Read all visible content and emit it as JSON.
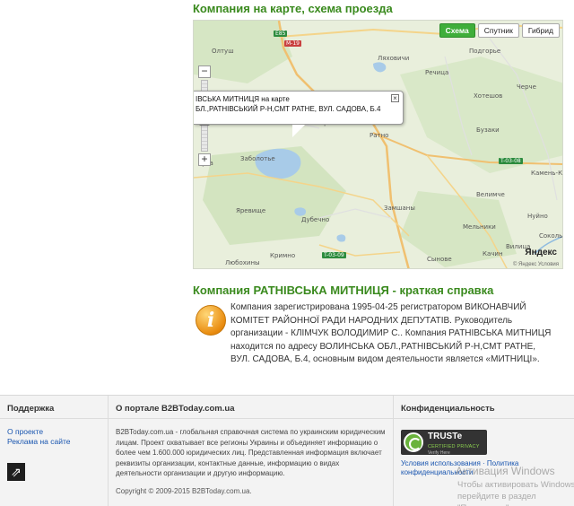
{
  "map_section": {
    "title": "Компания на карте, схема проезда",
    "map_types": [
      "Схема",
      "Спутник",
      "Гибрид"
    ],
    "active_type": "Схема",
    "zoom_in": "+",
    "zoom_out": "−",
    "balloon_line1": "ІВСЬКА МИТНИЦЯ на карте",
    "balloon_line2": "БЛ.,РАТНІВСЬКИЙ Р-Н,СМТ РАТНЕ, ВУЛ. САДОВА, Б.4",
    "balloon_close": "×",
    "places": [
      "Ляховичи",
      "Олтуш",
      "Жиричи",
      "Ратно",
      "Заболотье",
      "Гута",
      "Яревище",
      "Дубечно",
      "Кримно",
      "Любохины",
      "Речица",
      "Подгорье",
      "Черче",
      "Хотешов",
      "Бузаки",
      "Велимче",
      "Замшаны",
      "Сынове",
      "Качин",
      "Камень-Ка",
      "Нуйно",
      "Соколы",
      "Мельники",
      "Вилица"
    ],
    "roads": [
      "E85",
      "M-19",
      "T-03-08",
      "T-03-09"
    ],
    "yandex_logo": "Яндекс",
    "map_copyright": "© Яндекс Условия"
  },
  "summary_section": {
    "title": "Компания РАТНІВСЬКА МИТНИЦЯ - краткая справка",
    "icon_letter": "i",
    "text": "Компания зарегистрирована 1995-04-25 регистратором ВИКОНАВЧИЙ КОМІТЕТ РАЙОННОЇ РАДИ НАРОДНИХ ДЕПУТАТІВ. Руководитель организации - КЛІМЧУК ВОЛОДИМИР С.. Компания РАТНІВСЬКА МИТНИЦЯ находится по адресу ВОЛИНСЬКА ОБЛ.,РАТНІВСЬКИЙ Р-Н,СМТ РАТНЕ, ВУЛ. САДОВА, Б.4, основным видом деятельности является «МИТНИЦІ»."
  },
  "footer": {
    "support": {
      "heading": "Поддержка",
      "links": [
        "О проекте",
        "Реклама на сайте"
      ],
      "share_glyph": "⇗"
    },
    "about": {
      "heading": "О портале B2BToday.com.ua",
      "text": "B2BToday.com.ua - глобальная справочная система по украинским юридическим лицам. Проект охватывает все регионы Украины и объединяет информацию о более чем 1.600.000 юридических лиц. Представленная информация включает реквизиты организации, контактные данные, информацию о видах деятельности организации и другую информацию.",
      "copyright": "Copyright © 2009-2015 B2BToday.com.ua."
    },
    "privacy": {
      "heading": "Конфиденциальность",
      "badge_title": "TRUSTe",
      "badge_sub": "CERTIFIED PRIVACY",
      "badge_verify": "Verify Here",
      "links": "Условия использования · Политика конфиденциальности"
    }
  },
  "os_overlay": {
    "line1": "Активация Windows",
    "line2": "Чтобы активировать Windows, перейдите в раздел \"Параметры\"."
  }
}
